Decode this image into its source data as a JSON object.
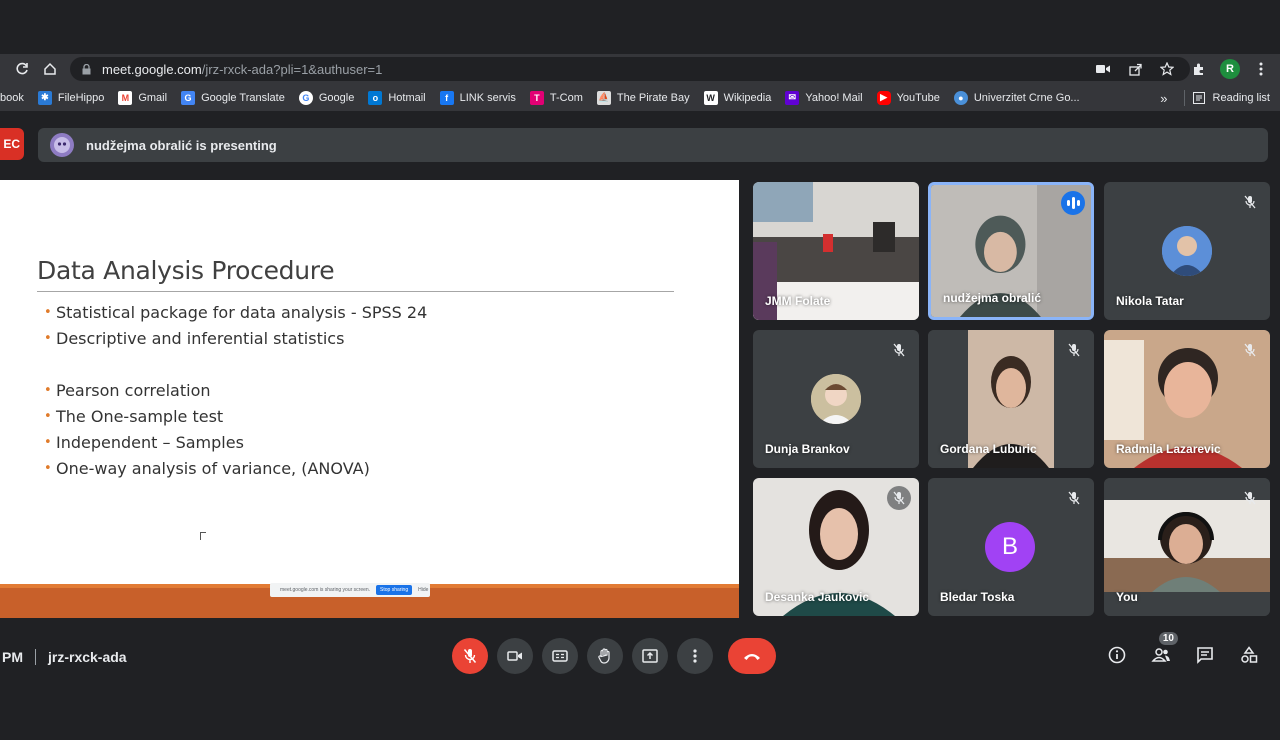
{
  "browser": {
    "url_host": "meet.google.com",
    "url_path": "/jrz-rxck-ada?pli=1&authuser=1",
    "profile_initial": "R",
    "bookmarks": [
      {
        "label": "book",
        "icon": "facebook-icon",
        "color": "#1877f2"
      },
      {
        "label": "FileHippo",
        "icon": "filehippo-icon",
        "color": "#2a7ad5"
      },
      {
        "label": "Gmail",
        "icon": "gmail-icon",
        "color": "#ea4335"
      },
      {
        "label": "Google Translate",
        "icon": "translate-icon",
        "color": "#4285f4"
      },
      {
        "label": "Google",
        "icon": "google-icon",
        "color": "#ffffff"
      },
      {
        "label": "Hotmail",
        "icon": "hotmail-icon",
        "color": "#0078d4"
      },
      {
        "label": "LINK servis",
        "icon": "facebook-icon",
        "color": "#1877f2"
      },
      {
        "label": "T-Com",
        "icon": "tcom-icon",
        "color": "#e20074"
      },
      {
        "label": "The Pirate Bay",
        "icon": "pirate-bay-icon",
        "color": "#dddddd"
      },
      {
        "label": "Wikipedia",
        "icon": "wikipedia-icon",
        "color": "#ffffff"
      },
      {
        "label": "Yahoo! Mail",
        "icon": "yahoo-icon",
        "color": "#6001d2"
      },
      {
        "label": "YouTube",
        "icon": "youtube-icon",
        "color": "#ff0000"
      },
      {
        "label": "Univerzitet Crne Go...",
        "icon": "university-icon",
        "color": "#4a90d9"
      }
    ],
    "overflow_label": "»",
    "reading_list_label": "Reading list"
  },
  "meet": {
    "rec_label": "EC",
    "presenting_text": "nudžejma obralić is presenting",
    "slide": {
      "title": "Data Analysis Procedure",
      "bullets_group1": [
        "Statistical package for data analysis - SPSS 24",
        "Descriptive and inferential statistics"
      ],
      "bullets_group2": [
        "Pearson correlation",
        "The One-sample test",
        "Independent – Samples",
        "One-way analysis of variance, (ANOVA)"
      ],
      "share_notice": "meet.google.com is sharing your screen.",
      "stop_sharing": "Stop sharing",
      "hide": "Hide"
    },
    "participants": [
      {
        "name": "JMM Folate"
      },
      {
        "name": "nudžejma obralić"
      },
      {
        "name": "Nikola Tatar"
      },
      {
        "name": "Dunja Brankov"
      },
      {
        "name": "Gordana Luburic"
      },
      {
        "name": "Radmila Lazarevic"
      },
      {
        "name": "Desanka Jaukovic"
      },
      {
        "name": "Bledar Toska",
        "initial": "B"
      },
      {
        "name": "You"
      }
    ],
    "time_fragment": "PM",
    "meeting_code": "jrz-rxck-ada",
    "participant_count": "10"
  }
}
